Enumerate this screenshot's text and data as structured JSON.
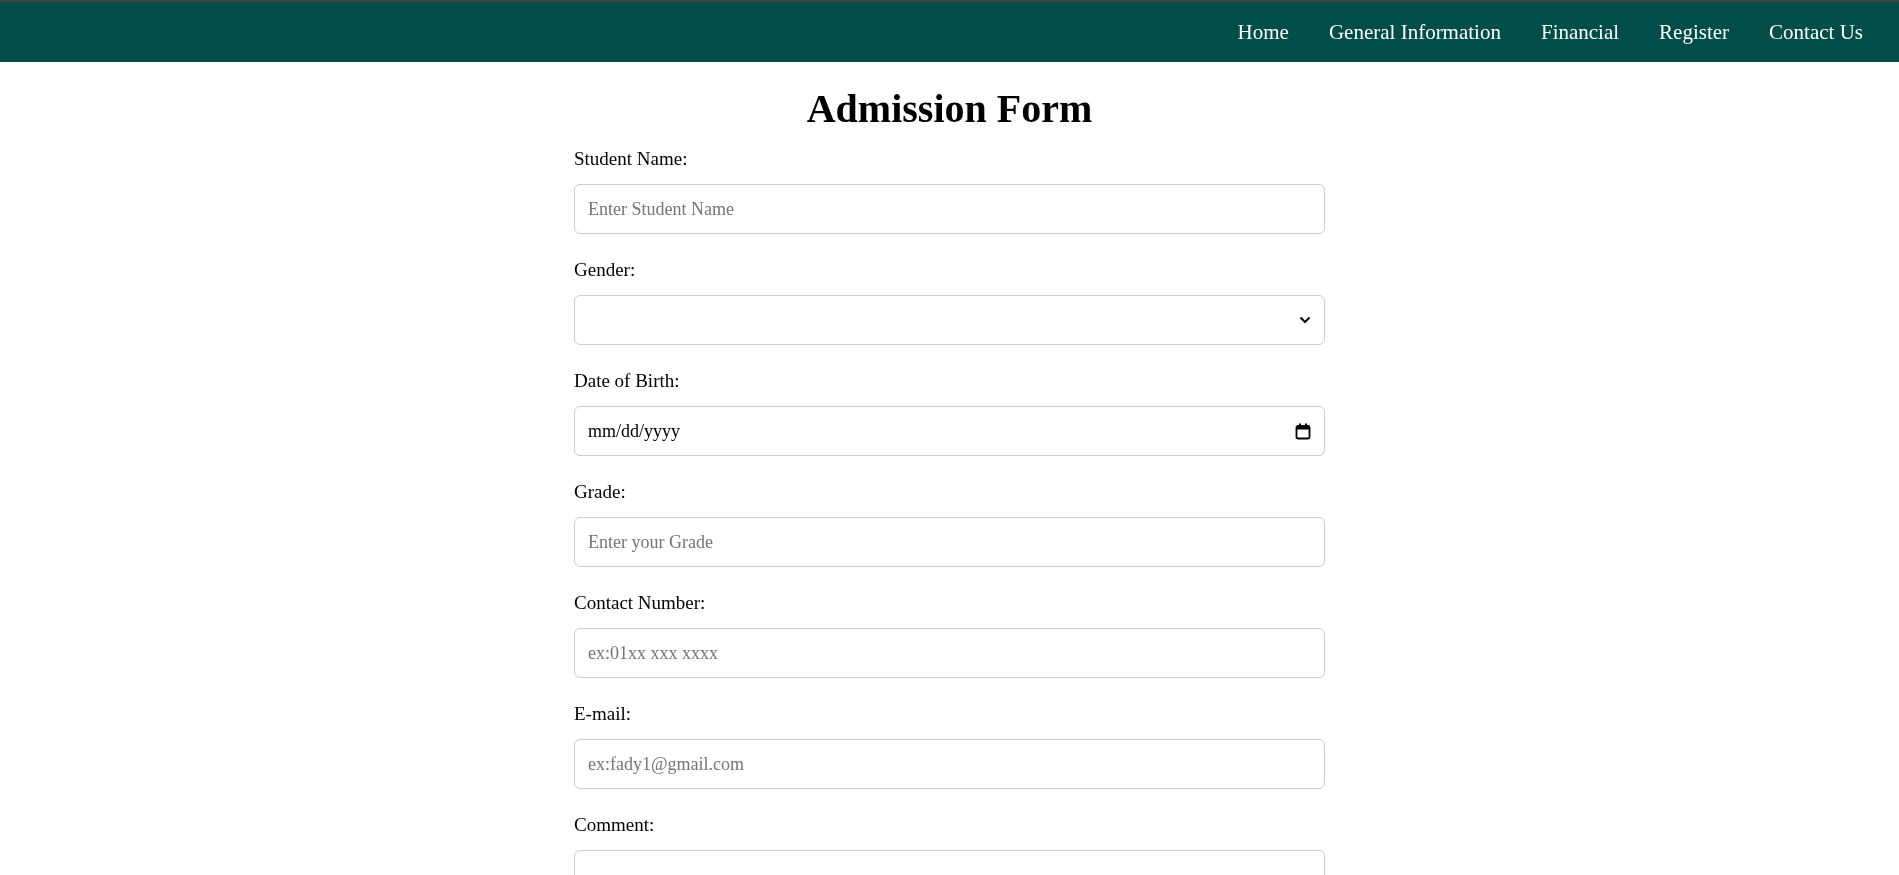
{
  "nav": {
    "items": [
      {
        "label": "Home"
      },
      {
        "label": "General Information"
      },
      {
        "label": "Financial"
      },
      {
        "label": "Register"
      },
      {
        "label": "Contact Us"
      }
    ]
  },
  "form": {
    "title": "Admission Form",
    "fields": [
      {
        "kind": "text",
        "label": "Student Name:",
        "placeholder": "Enter Student Name"
      },
      {
        "kind": "select",
        "label": "Gender:"
      },
      {
        "kind": "date",
        "label": "Date of Birth:",
        "value": "mm/dd/yyyy"
      },
      {
        "kind": "text",
        "label": "Grade:",
        "placeholder": "Enter your Grade"
      },
      {
        "kind": "text",
        "label": "Contact Number:",
        "placeholder": "ex:01xx xxx xxxx"
      },
      {
        "kind": "text",
        "label": "E-mail:",
        "placeholder": "ex:fady1@gmail.com"
      },
      {
        "kind": "textarea",
        "label": "Comment:"
      }
    ]
  }
}
